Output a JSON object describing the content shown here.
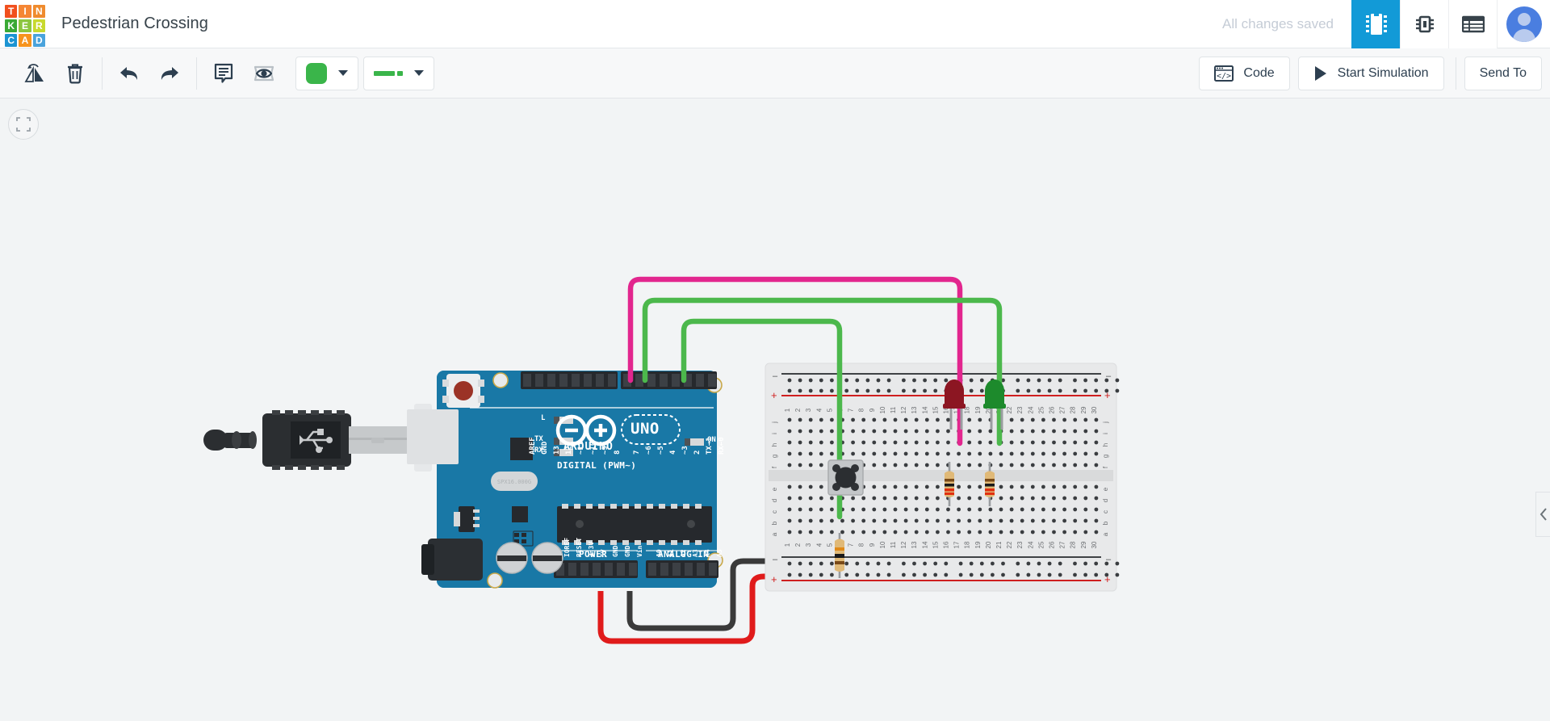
{
  "app": {
    "logo_letters": [
      "T",
      "I",
      "N",
      "K",
      "E",
      "R",
      "C",
      "A",
      "D"
    ],
    "logo_colors": [
      "#f1501e",
      "#f58634",
      "#ef8b2e",
      "#3aa935",
      "#8cc63f",
      "#c8d92e",
      "#1c94d2",
      "#f7941e",
      "#4aa3dc"
    ],
    "doc_title": "Pedestrian Crossing",
    "save_status": "All changes saved",
    "header_icons": [
      {
        "name": "circuits-view-icon",
        "label": "Circuits",
        "active": true
      },
      {
        "name": "components-view-icon",
        "label": "Components",
        "active": false
      },
      {
        "name": "list-view-icon",
        "label": "Component List",
        "active": false
      }
    ],
    "avatar_label": "User Account"
  },
  "toolbar": {
    "rotate_label": "Rotate",
    "delete_label": "Delete",
    "undo_label": "Undo",
    "redo_label": "Redo",
    "notes_label": "Notes",
    "visibility_label": "Hide / Show",
    "color_swatch": "#3ab54a",
    "color_label": "Wire Color",
    "wire_style_color": "#3ab54a",
    "wire_style_label": "Wire Type",
    "code_label": "Code",
    "simulation_label": "Start Simulation",
    "send_to_label": "Send To",
    "fit_label": "Fit view to selection"
  },
  "canvas": {
    "collapse_label": "Collapse panel",
    "zoom_hint": ""
  },
  "circuit": {
    "board": {
      "name": "Arduino Uno R3",
      "brand": "ARDUINO",
      "model": "UNO",
      "digital_header_label": "DIGITAL (PWM~)",
      "digital_pins": [
        "AREF",
        "GND",
        "13",
        "12",
        "~11",
        "~10",
        "~9",
        "8",
        "7",
        "~6",
        "~5",
        "4",
        "~3",
        "2",
        "TX→1",
        "RX←0"
      ],
      "power_header_label": "POWER",
      "power_pins": [
        "IOREF",
        "RESET",
        "3.3V",
        "5V",
        "GND",
        "GND",
        "Vin"
      ],
      "analog_header_label": "ANALOG IN",
      "analog_pins": [
        "A0",
        "A1",
        "A2",
        "A3",
        "A4",
        "A5"
      ],
      "status_leds": [
        "L",
        "TX",
        "RX"
      ],
      "power_led": "ON",
      "crystal_text": "SPX16.000G"
    },
    "breadboard": {
      "name": "Breadboard Small",
      "rows_top": [
        "j",
        "i",
        "h",
        "g",
        "f"
      ],
      "rows_bottom": [
        "e",
        "d",
        "c",
        "b",
        "a"
      ],
      "columns": 30,
      "rail_plus": "+",
      "rail_minus": "-"
    },
    "components": [
      {
        "name": "pushbutton",
        "type": "Pushbutton",
        "column": 6
      },
      {
        "name": "led-red",
        "type": "LED",
        "color": "#8c1622",
        "column": 17
      },
      {
        "name": "led-green",
        "type": "LED",
        "color": "#1d8a2c",
        "column": 21
      },
      {
        "name": "resistor-pulldown",
        "type": "Resistor 10 kΩ",
        "bands": [
          "#e08a1a",
          "#1a1a1a",
          "#7a4a18"
        ],
        "column": 6
      },
      {
        "name": "resistor-red-led",
        "type": "Resistor 220 Ω",
        "bands": [
          "#7a4a18",
          "#1a1a1a",
          "#e03010"
        ],
        "column": 17
      },
      {
        "name": "resistor-green-led",
        "type": "Resistor 220 Ω",
        "bands": [
          "#7a4a18",
          "#1a1a1a",
          "#e03010"
        ],
        "column": 21
      }
    ],
    "wires": [
      {
        "name": "wire-pin7-to-red-led",
        "color": "#e2268e",
        "from": "Digital 7",
        "to": "Red LED anode"
      },
      {
        "name": "wire-pin6-to-green-led",
        "color": "#4cb84c",
        "from": "Digital ~6",
        "to": "Green LED anode"
      },
      {
        "name": "wire-pin2-to-button",
        "color": "#4cb84c",
        "from": "Digital 2",
        "to": "Pushbutton"
      },
      {
        "name": "wire-5v-to-rail",
        "color": "#e01b1b",
        "from": "5V",
        "to": "Breadboard + rail"
      },
      {
        "name": "wire-gnd-to-rail",
        "color": "#3a3a3a",
        "from": "GND",
        "to": "Breadboard - rail"
      }
    ],
    "usb_cable": {
      "name": "USB cable",
      "symbol": "USB"
    }
  }
}
